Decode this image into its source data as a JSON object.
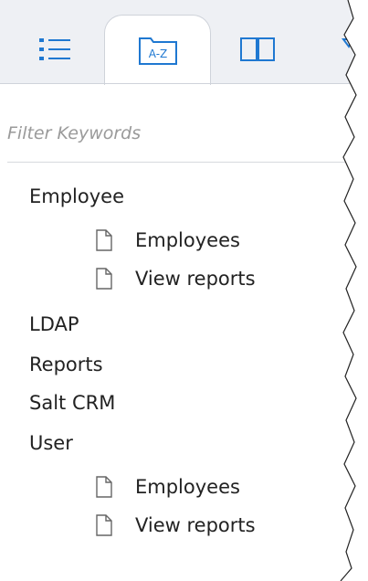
{
  "tabs": [
    {
      "label": "",
      "icon": "list-icon",
      "active": false
    },
    {
      "label": "A-Z",
      "icon": "az-index-icon",
      "active": true
    },
    {
      "label": "",
      "icon": "book-icon",
      "active": false
    },
    {
      "label": "",
      "icon": "search-icon",
      "active": false
    }
  ],
  "filter": {
    "placeholder": "Filter Keywords",
    "value": ""
  },
  "tree": [
    {
      "label": "Employee",
      "children": [
        "Employees",
        "View reports"
      ]
    },
    {
      "label": "LDAP",
      "children": []
    },
    {
      "label": "Reports",
      "children": []
    },
    {
      "label": "Salt CRM",
      "children": []
    },
    {
      "label": "User",
      "children": [
        "Employees",
        "View reports"
      ]
    }
  ],
  "colors": {
    "accent": "#1f78d1",
    "tab_bg": "#eef0f4",
    "text": "#222222",
    "placeholder": "#9a9a9a"
  }
}
